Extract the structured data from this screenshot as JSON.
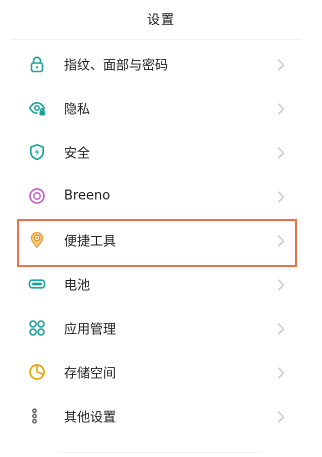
{
  "header": {
    "title": "设置"
  },
  "settings": {
    "items": [
      {
        "label": "指纹、面部与密码",
        "icon": "lock-icon"
      },
      {
        "label": "隐私",
        "icon": "privacy-eye-icon"
      },
      {
        "label": "安全",
        "icon": "shield-bolt-icon"
      },
      {
        "label": "Breeno",
        "icon": "breeno-ring-icon"
      },
      {
        "label": "便捷工具",
        "icon": "convenience-tools-icon"
      },
      {
        "label": "电池",
        "icon": "battery-icon"
      },
      {
        "label": "应用管理",
        "icon": "app-management-icon"
      },
      {
        "label": "存储空间",
        "icon": "storage-pie-icon"
      },
      {
        "label": "其他设置",
        "icon": "other-settings-dots-icon"
      }
    ]
  },
  "highlighted_item": "便捷工具",
  "colors": {
    "accent": "#1aa39a",
    "highlight_border": "#e8734a",
    "breeno": "#c267c7",
    "storage": "#e9a400",
    "tools": "#e3a23a",
    "chevron": "#c8c8c8"
  }
}
